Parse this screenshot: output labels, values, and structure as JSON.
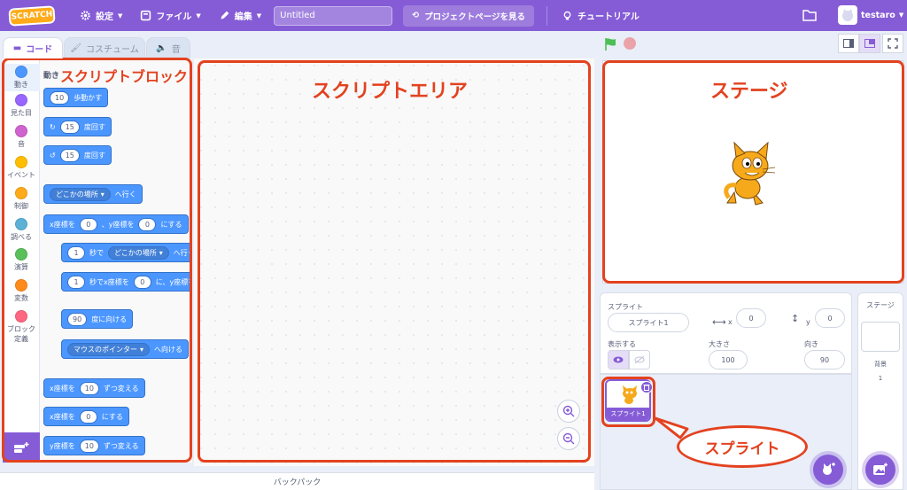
{
  "menubar": {
    "logo": "SCRATCH",
    "settings": "設定",
    "file": "ファイル",
    "edit": "編集",
    "project_title": "Untitled",
    "project_page": "プロジェクトページを見る",
    "tutorial": "チュートリアル",
    "username": "testaro"
  },
  "tabs": {
    "code": "コード",
    "costume": "コスチューム",
    "sound": "音"
  },
  "categories": [
    {
      "label": "動き",
      "color": "#4c97ff"
    },
    {
      "label": "見た目",
      "color": "#9966ff"
    },
    {
      "label": "音",
      "color": "#cf63cf"
    },
    {
      "label": "イベント",
      "color": "#ffbf00"
    },
    {
      "label": "制御",
      "color": "#ffab19"
    },
    {
      "label": "調べる",
      "color": "#5cb1d6"
    },
    {
      "label": "演算",
      "color": "#59c059"
    },
    {
      "label": "変数",
      "color": "#ff8c1a"
    },
    {
      "label": "ブロック定義",
      "color": "#ff6680"
    }
  ],
  "palette": {
    "heading": "動き",
    "blocks": {
      "move": {
        "value": "10",
        "text": "歩動かす"
      },
      "turn_right": {
        "value": "15",
        "text": "度回す"
      },
      "turn_left": {
        "value": "15",
        "text": "度回す"
      },
      "goto": {
        "dropdown": "どこかの場所",
        "text": "へ行く"
      },
      "gotoxy": {
        "prefix": "x座標を",
        "x": "0",
        "mid": "、y座標を",
        "y": "0",
        "suffix": "にする"
      },
      "glide": {
        "value": "1",
        "mid": "秒で",
        "dropdown": "どこかの場所",
        "text": "へ行く"
      },
      "glidexy": {
        "value": "1",
        "mid": "秒でx座標を",
        "x": "0",
        "mid2": "に、y座標を"
      },
      "point_dir": {
        "value": "90",
        "text": "度に向ける"
      },
      "point_towards": {
        "dropdown": "マウスのポインター",
        "text": "へ向ける"
      },
      "change_x": {
        "prefix": "x座標を",
        "value": "10",
        "suffix": "ずつ変える"
      },
      "set_x": {
        "prefix": "x座標を",
        "value": "0",
        "suffix": "にする"
      },
      "change_y": {
        "prefix": "y座標を",
        "value": "10",
        "suffix": "ずつ変える"
      }
    }
  },
  "backpack": "バックパック",
  "sprite_info": {
    "sprite_label": "スプライト",
    "sprite_name": "スプライト1",
    "x_label": "x",
    "x_value": "0",
    "y_label": "y",
    "y_value": "0",
    "show_label": "表示する",
    "size_label": "大きさ",
    "size_value": "100",
    "direction_label": "向き",
    "direction_value": "90"
  },
  "sprite_tile": {
    "name": "スプライト1"
  },
  "stage_panel": {
    "title": "ステージ",
    "backdrop_label": "背景",
    "backdrop_count": "1"
  },
  "annotations": {
    "script_blocks": "スクリプトブロック",
    "script_area": "スクリプトエリア",
    "stage": "ステージ",
    "sprite": "スプライト"
  }
}
